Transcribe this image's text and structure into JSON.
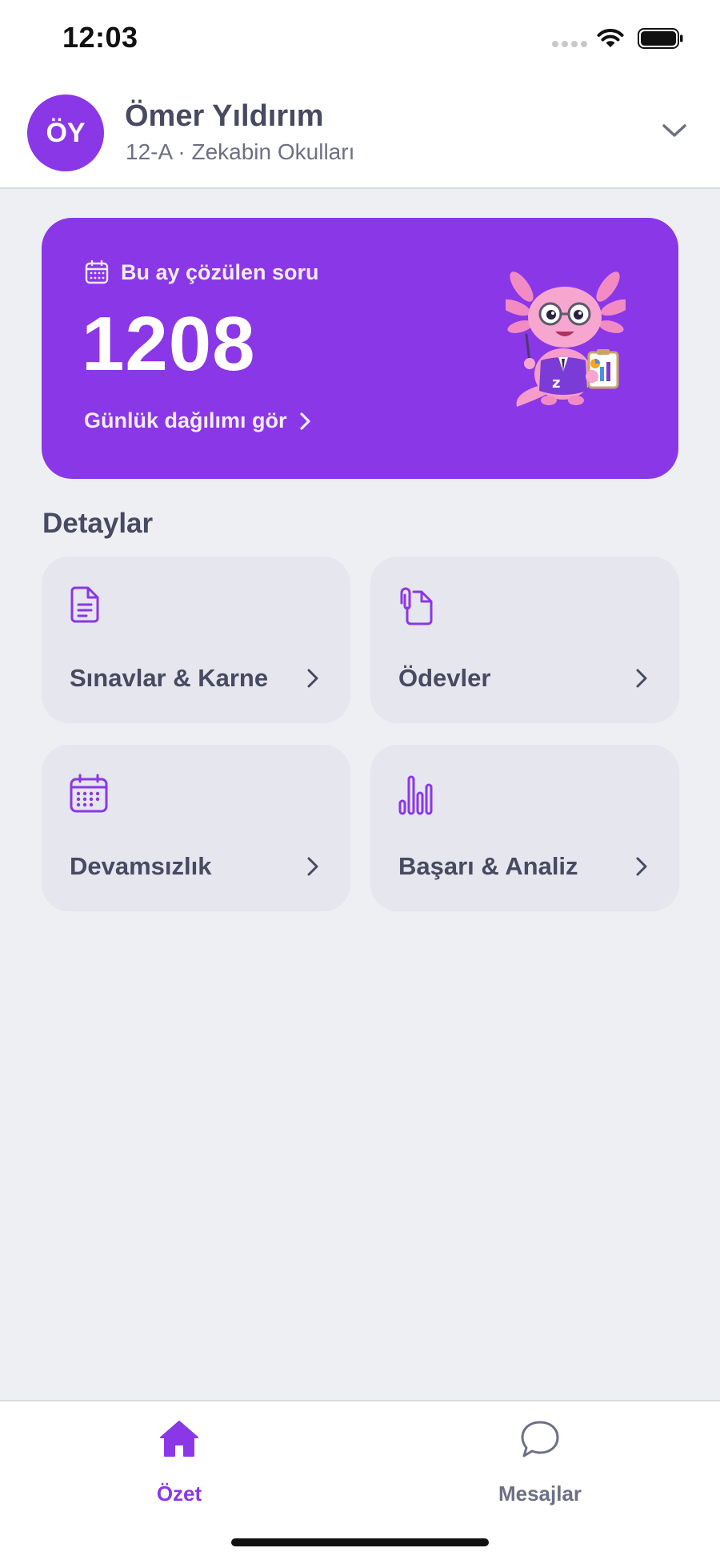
{
  "status_bar": {
    "time": "12:03"
  },
  "header": {
    "avatar_initials": "ÖY",
    "name": "Ömer Yıldırım",
    "subtitle": "12-A · Zekabin Okulları"
  },
  "hero": {
    "label": "Bu ay çözülen soru",
    "value": "1208",
    "link": "Günlük dağılımı gör"
  },
  "details": {
    "title": "Detaylar",
    "tiles": [
      {
        "label": "Sınavlar & Karne",
        "icon": "document-icon"
      },
      {
        "label": "Ödevler",
        "icon": "paperclip-document-icon"
      },
      {
        "label": "Devamsızlık",
        "icon": "calendar-icon"
      },
      {
        "label": "Başarı & Analiz",
        "icon": "bar-chart-icon"
      }
    ]
  },
  "tab_bar": {
    "tabs": [
      {
        "label": "Özet",
        "icon": "home-icon",
        "active": true
      },
      {
        "label": "Mesajlar",
        "icon": "chat-bubble-icon",
        "active": false
      }
    ]
  },
  "colors": {
    "accent": "#8A37E8",
    "background": "#EEEFF3",
    "tile": "#E5E6EE",
    "text": "#474A60",
    "inactive_tab": "#6D7085"
  }
}
